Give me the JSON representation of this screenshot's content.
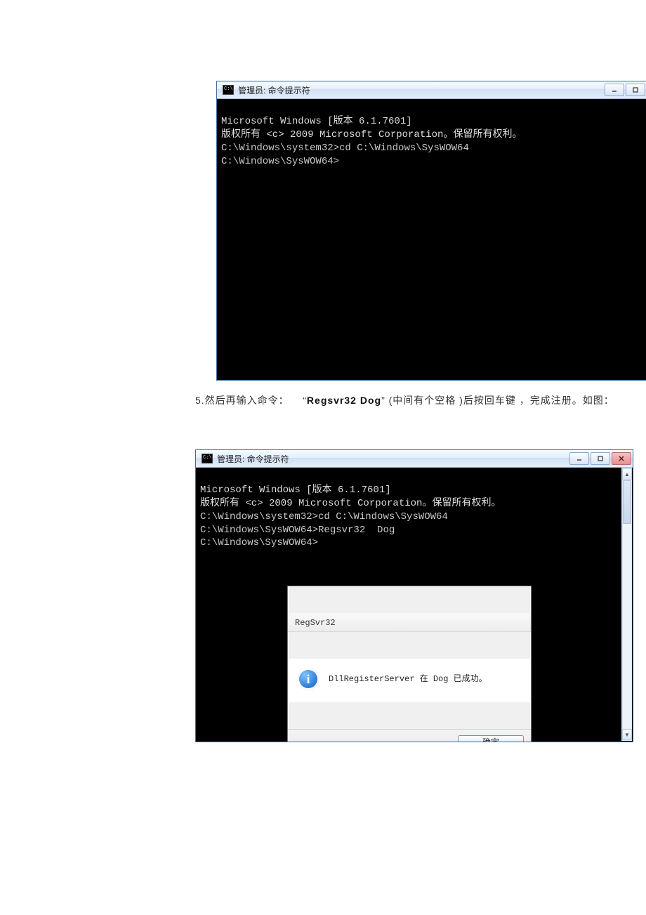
{
  "console1": {
    "title": "管理员: 命令提示符",
    "lines": [
      "Microsoft Windows [版本 6.1.7601]",
      "版权所有 <c> 2009 Microsoft Corporation。保留所有权利。",
      "",
      "C:\\Windows\\system32>cd C:\\Windows\\SysWOW64",
      "",
      "C:\\Windows\\SysWOW64>"
    ]
  },
  "instruction": {
    "prefix": "5.然后再输入命令：",
    "quoted_open": "“",
    "quoted_cmd": "Regsvr32   Dog",
    "quoted_close": "”",
    "note_paren": "(中间有个空格  )",
    "tail": "后按回车键 ，完成注册。如图："
  },
  "console2": {
    "title": "管理员: 命令提示符",
    "lines": [
      "Microsoft Windows [版本 6.1.7601]",
      "版权所有 <c> 2009 Microsoft Corporation。保留所有权利。",
      "",
      "C:\\Windows\\system32>cd C:\\Windows\\SysWOW64",
      "",
      "C:\\Windows\\SysWOW64>Regsvr32  Dog",
      "",
      "C:\\Windows\\SysWOW64>"
    ],
    "dialog": {
      "title": "RegSvr32",
      "message": "DllRegisterServer 在 Dog 已成功。",
      "ok_label": "确定"
    }
  },
  "win_controls": {
    "minimize": "–",
    "maximize": "□",
    "close": "✕"
  }
}
